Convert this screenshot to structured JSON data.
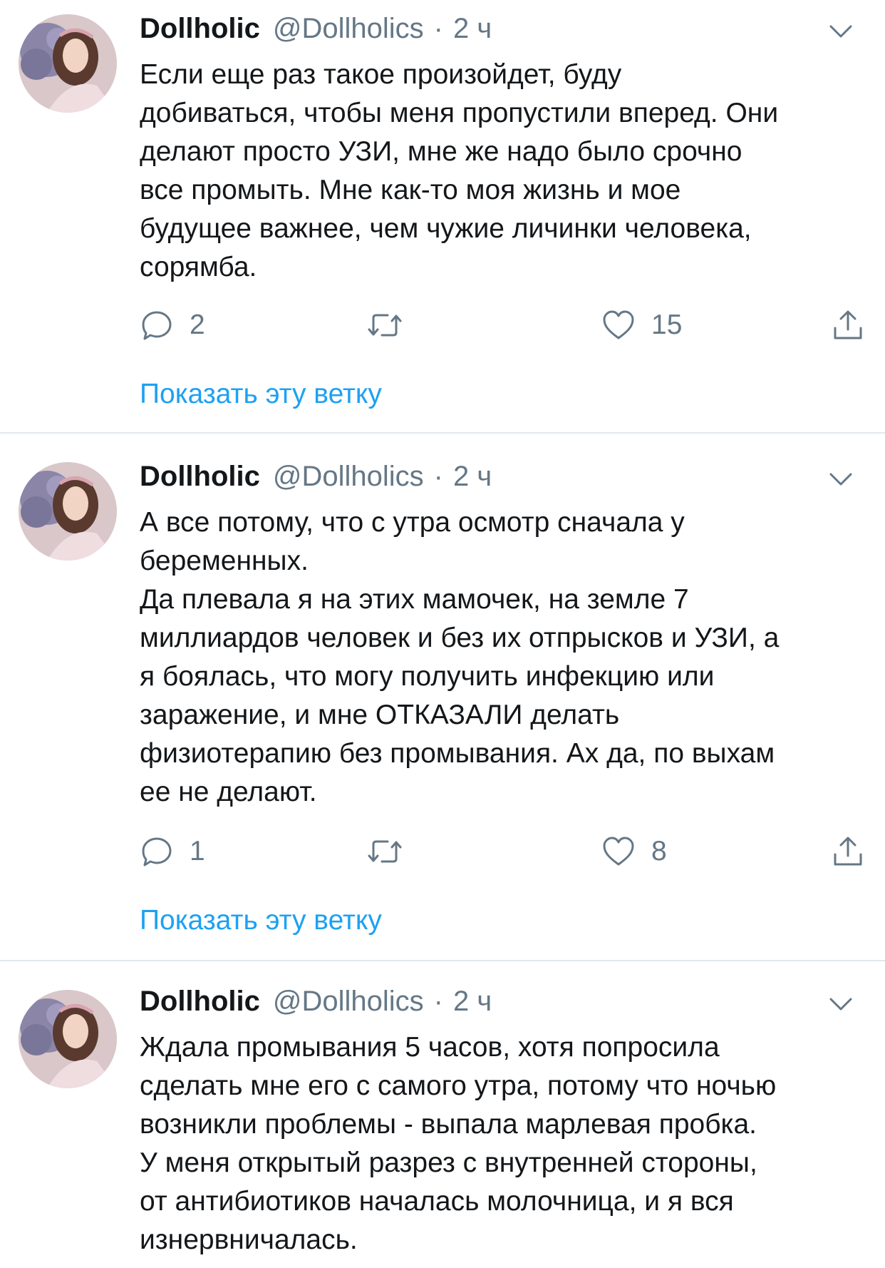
{
  "tweets": [
    {
      "author_name": "Dollholic",
      "author_handle": "@Dollholics",
      "separator": "·",
      "time": "2 ч",
      "text": "Если еще раз такое произойдет,  буду\nдобиваться, чтобы меня пропустили вперед. Они\nделают просто УЗИ,  мне же надо было срочно\nвсе промыть. Мне как-то моя жизнь и мое\nбудущее важнее, чем чужие личинки человека,\nсорямба.",
      "reply_count": "2",
      "retweet_count": "",
      "like_count": "15",
      "show_thread": "Показать эту ветку"
    },
    {
      "author_name": "Dollholic",
      "author_handle": "@Dollholics",
      "separator": "·",
      "time": "2 ч",
      "text": "А все потому, что с утра осмотр сначала у\nбеременных.\nДа плевала я на этих мамочек, на земле 7\nмиллиардов человек и без их отпрысков и УЗИ, а\nя боялась, что могу получить инфекцию или\nзаражение, и мне ОТКАЗАЛИ делать\nфизиотерапию без промывания. Ах да, по выхам\nее не делают.",
      "reply_count": "1",
      "retweet_count": "",
      "like_count": "8",
      "show_thread": "Показать эту ветку"
    },
    {
      "author_name": "Dollholic",
      "author_handle": "@Dollholics",
      "separator": "·",
      "time": "2 ч",
      "text": "Ждала промывания 5 часов,  хотя попросила\nсделать мне его с самого утра, потому что ночью\nвозникли проблемы - выпала марлевая пробка.\nУ меня открытый разрез с внутренней стороны,\nот антибиотиков началась молочница, и я вся\nизнервничалась."
    }
  ],
  "icons": {
    "reply": "reply-icon",
    "retweet": "retweet-icon",
    "like": "heart-icon",
    "share": "share-icon",
    "menu": "chevron-down-icon"
  },
  "colors": {
    "text": "#14171a",
    "secondary": "#657786",
    "link": "#1da1f2",
    "divider": "#e1e8ed"
  }
}
